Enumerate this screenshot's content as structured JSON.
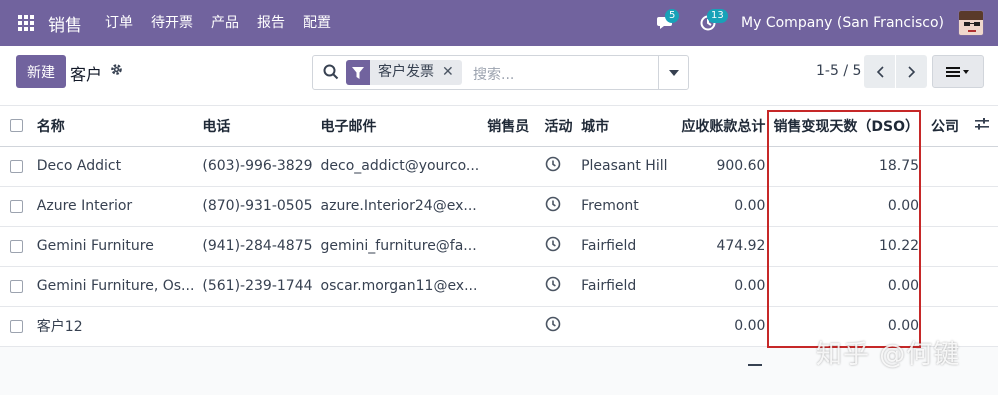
{
  "navbar": {
    "app_name": "销售",
    "menu": [
      "订单",
      "待开票",
      "产品",
      "报告",
      "配置"
    ],
    "messages_badge": "5",
    "activities_badge": "13",
    "company": "My Company (San Francisco)"
  },
  "control": {
    "new_label": "新建",
    "breadcrumb": "客户",
    "search": {
      "facet_label": "客户发票",
      "placeholder": "搜索..."
    },
    "pager": "1-5 / 5"
  },
  "table": {
    "columns": [
      "名称",
      "电话",
      "电子邮件",
      "销售员",
      "活动",
      "城市",
      "应收账款总计",
      "销售变现天数（DSO）",
      "公司"
    ],
    "rows": [
      {
        "name": "Deco Addict",
        "phone": "(603)-996-3829",
        "email": "deco_addict@yourco...",
        "salesperson": "",
        "city": "Pleasant Hill",
        "receivable": "900.60",
        "dso": "18.75",
        "company": ""
      },
      {
        "name": "Azure Interior",
        "phone": "(870)-931-0505",
        "email": "azure.Interior24@ex...",
        "salesperson": "",
        "city": "Fremont",
        "receivable": "0.00",
        "dso": "0.00",
        "company": ""
      },
      {
        "name": "Gemini Furniture",
        "phone": "(941)-284-4875",
        "email": "gemini_furniture@fa...",
        "salesperson": "",
        "city": "Fairfield",
        "receivable": "474.92",
        "dso": "10.22",
        "company": ""
      },
      {
        "name": "Gemini Furniture, Os...",
        "phone": "(561)-239-1744",
        "email": "oscar.morgan11@ex...",
        "salesperson": "",
        "city": "Fairfield",
        "receivable": "0.00",
        "dso": "0.00",
        "company": ""
      },
      {
        "name": "客户12",
        "phone": "",
        "email": "",
        "salesperson": "",
        "city": "",
        "receivable": "0.00",
        "dso": "0.00",
        "company": ""
      }
    ]
  },
  "watermark": "知乎 @何键",
  "colors": {
    "brand": "#71639e",
    "highlight": "#c62828",
    "badge": "#17a2b8"
  }
}
